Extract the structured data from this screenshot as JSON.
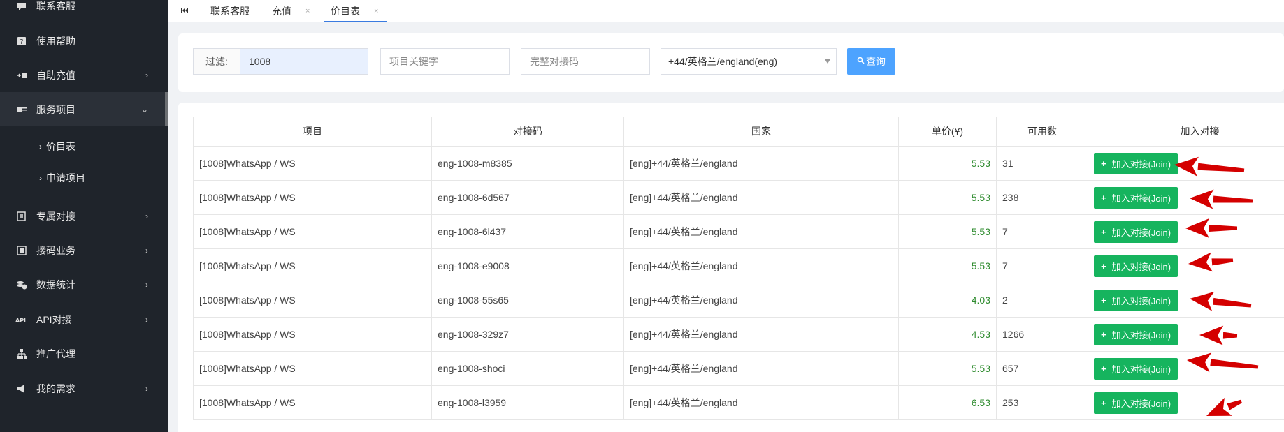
{
  "sidebar": {
    "items": [
      {
        "label": "联系客服",
        "icon": "chat-icon",
        "has_chevron": false
      },
      {
        "label": "使用帮助",
        "icon": "help-icon",
        "has_chevron": false
      },
      {
        "label": "自助充值",
        "icon": "recharge-icon",
        "has_chevron": true
      },
      {
        "label": "服务项目",
        "icon": "service-icon",
        "has_chevron": true,
        "expanded": true
      },
      {
        "label": "专属对接",
        "icon": "exclusive-icon",
        "has_chevron": true
      },
      {
        "label": "接码业务",
        "icon": "code-icon",
        "has_chevron": true
      },
      {
        "label": "数据统计",
        "icon": "stats-icon",
        "has_chevron": true
      },
      {
        "label": "API对接",
        "icon": "api-icon",
        "has_chevron": true
      },
      {
        "label": "推广代理",
        "icon": "network-icon",
        "has_chevron": false
      },
      {
        "label": "我的需求",
        "icon": "megaphone-icon",
        "has_chevron": true
      }
    ],
    "subitems": [
      {
        "label": "价目表"
      },
      {
        "label": "申请项目"
      }
    ]
  },
  "tabs": [
    {
      "label": "联系客服",
      "closable": false
    },
    {
      "label": "充值",
      "closable": true
    },
    {
      "label": "价目表",
      "closable": true,
      "active": true
    }
  ],
  "filter": {
    "label": "过滤:",
    "code_value": "1008",
    "keyword_placeholder": "项目关键字",
    "full_code_placeholder": "完整对接码",
    "country_selected": "+44/英格兰/england(eng)",
    "query_label": "查询"
  },
  "table": {
    "headers": [
      "项目",
      "对接码",
      "国家",
      "单价(¥)",
      "可用数",
      "加入对接"
    ],
    "join_label": "加入对接(Join)",
    "rows": [
      {
        "project": "[1008]WhatsApp / WS",
        "code": "eng-1008-m8385",
        "country": "[eng]+44/英格兰/england",
        "price": "5.53",
        "available": "31"
      },
      {
        "project": "[1008]WhatsApp / WS",
        "code": "eng-1008-6d567",
        "country": "[eng]+44/英格兰/england",
        "price": "5.53",
        "available": "238"
      },
      {
        "project": "[1008]WhatsApp / WS",
        "code": "eng-1008-6l437",
        "country": "[eng]+44/英格兰/england",
        "price": "5.53",
        "available": "7"
      },
      {
        "project": "[1008]WhatsApp / WS",
        "code": "eng-1008-e9008",
        "country": "[eng]+44/英格兰/england",
        "price": "5.53",
        "available": "7"
      },
      {
        "project": "[1008]WhatsApp / WS",
        "code": "eng-1008-55s65",
        "country": "[eng]+44/英格兰/england",
        "price": "4.03",
        "available": "2"
      },
      {
        "project": "[1008]WhatsApp / WS",
        "code": "eng-1008-329z7",
        "country": "[eng]+44/英格兰/england",
        "price": "4.53",
        "available": "1266"
      },
      {
        "project": "[1008]WhatsApp / WS",
        "code": "eng-1008-shoci",
        "country": "[eng]+44/英格兰/england",
        "price": "5.53",
        "available": "657"
      },
      {
        "project": "[1008]WhatsApp / WS",
        "code": "eng-1008-l3959",
        "country": "[eng]+44/英格兰/england",
        "price": "6.53",
        "available": "253"
      }
    ]
  },
  "colors": {
    "sidebar_bg": "#1f242b",
    "join_button": "#16b45e",
    "query_button": "#4da3ff",
    "price_text": "#2e8b2e",
    "annotation_arrow": "#d40000"
  }
}
